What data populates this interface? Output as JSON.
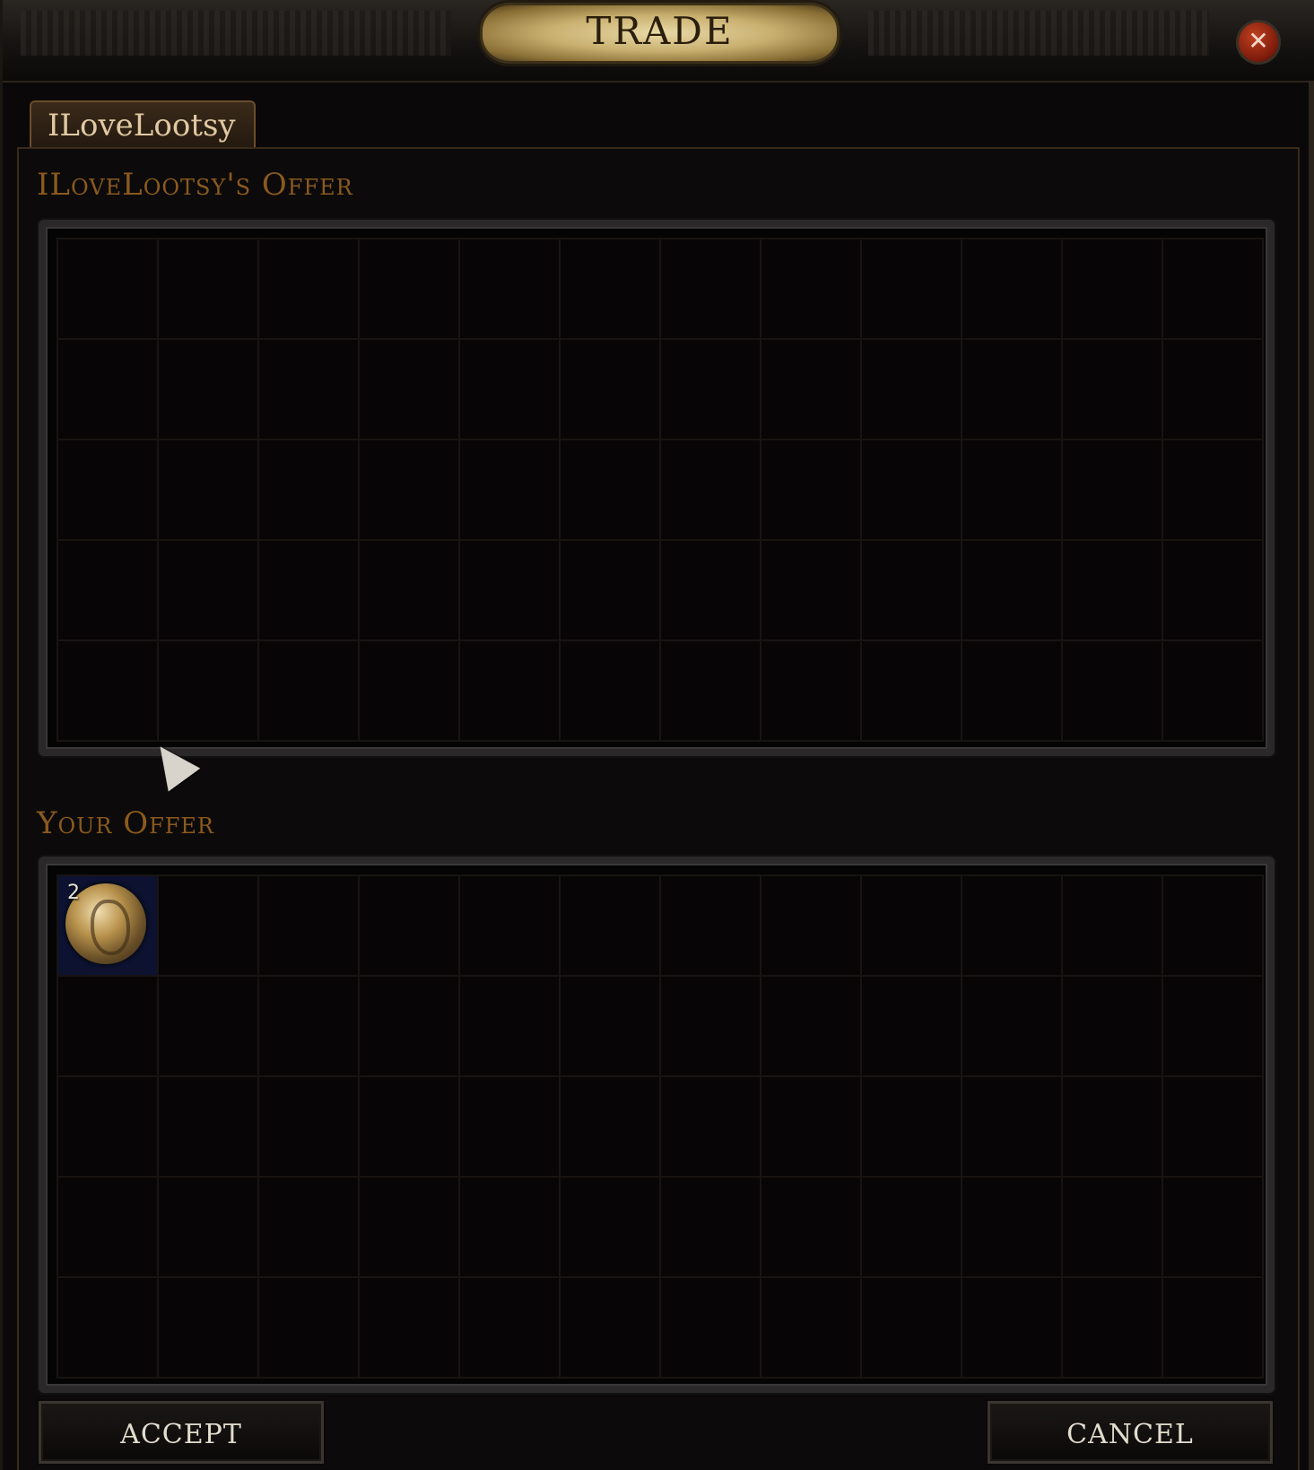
{
  "window": {
    "title": "TRADE",
    "close_symbol": "✕"
  },
  "tab": {
    "label": "ILoveLootsy"
  },
  "their_offer": {
    "label": "ILoveLootsy's Offer",
    "columns": 12,
    "rows": 5,
    "items": []
  },
  "your_offer": {
    "label": "Your Offer",
    "columns": 12,
    "rows": 5,
    "items": [
      {
        "icon": "currency-orb-icon",
        "stack": "2",
        "slot_column": 1,
        "slot_row": 1
      }
    ]
  },
  "buttons": {
    "accept": "ACCEPT",
    "cancel": "CANCEL"
  },
  "colors": {
    "section_label": "#8a5a1e",
    "tab_text": "#e0c9a2",
    "close_button": "#a83018",
    "filled_slot": "#0c1230"
  }
}
